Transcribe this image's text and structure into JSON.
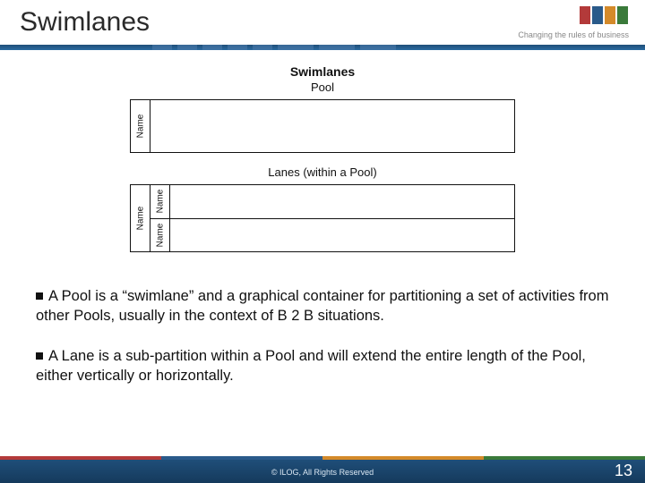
{
  "header": {
    "title": "Swimlanes",
    "tagline": "Changing the rules of business",
    "logo_alt": "ILOG"
  },
  "figure": {
    "title": "Swimlanes",
    "pool_caption": "Pool",
    "pool_label": "Name",
    "lanes_caption": "Lanes (within a Pool)",
    "lanes_outer_label": "Name",
    "lanes_row1_label": "Name",
    "lanes_row2_label": "Name"
  },
  "body": {
    "p1": "A Pool is a “swimlane” and a graphical container for partitioning a set of activities from other Pools, usually in the context of B 2 B situations.",
    "p2": "A Lane is a sub-partition within a Pool and will extend the entire length of the Pool, either vertically or horizontally."
  },
  "footer": {
    "copyright": "©  ILOG, All Rights Reserved",
    "page": "13"
  }
}
